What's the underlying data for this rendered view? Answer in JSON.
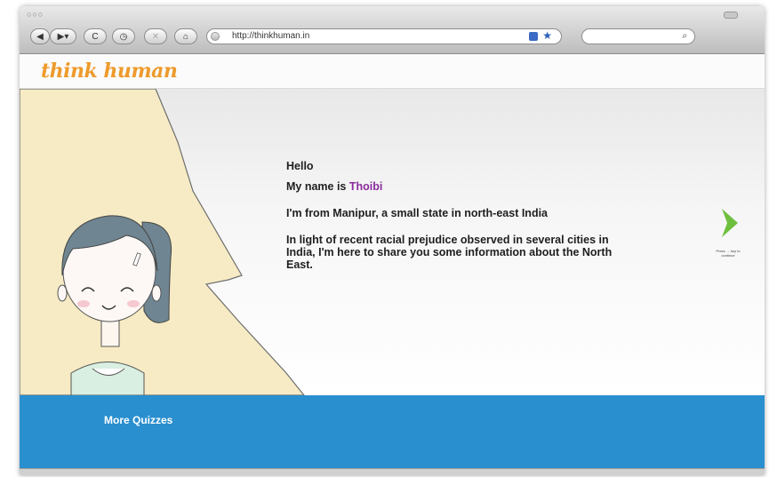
{
  "browser": {
    "url": "http://thinkhuman.in",
    "traffic_lights": "○○○"
  },
  "brand": {
    "logo_text": "think human",
    "logo_color": "#ee9a2c"
  },
  "intro": {
    "greeting": "Hello",
    "name_prefix": "My name is",
    "name": "Thoibi",
    "origin": "I'm from Manipur, a small state in north-east India",
    "purpose": "In light of recent racial prejudice observed in several cities in India, I'm here to share you some information about the North East."
  },
  "navigation": {
    "next_hint": "Press → key to continue"
  },
  "footer": {
    "more_quizzes": "More Quizzes",
    "color": "#2a8fcf"
  },
  "colors": {
    "name_accent": "#8a2b9c",
    "arrow_green": "#6fbf3f",
    "speech_area": "#f6ebc4"
  }
}
